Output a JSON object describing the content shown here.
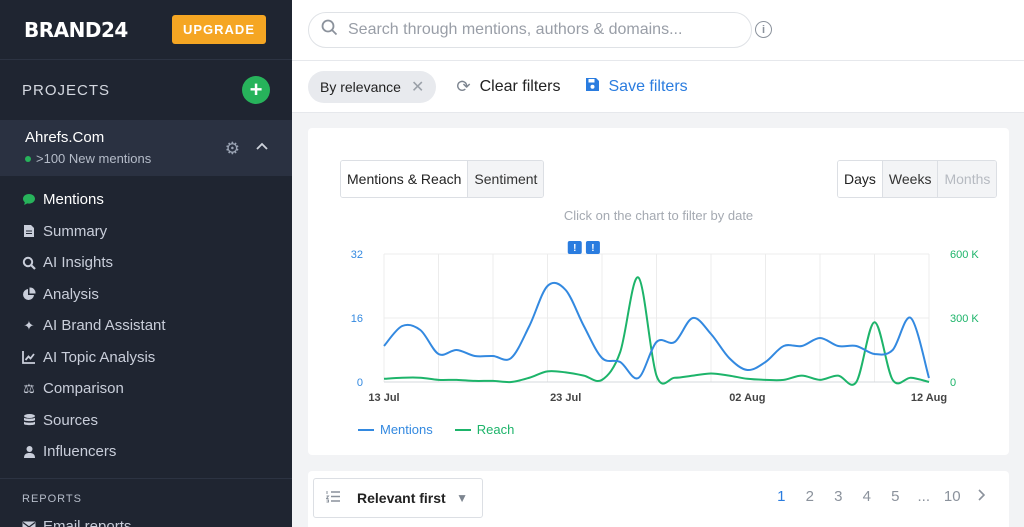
{
  "sidebar": {
    "logo": "BRAND24",
    "upgrade_label": "UPGRADE",
    "projects_label": "PROJECTS",
    "project": {
      "name": "Ahrefs.Com",
      "status": ">100 New mentions"
    },
    "items": [
      {
        "label": "Mentions",
        "icon": "chat-bubble-icon",
        "active": true
      },
      {
        "label": "Summary",
        "icon": "document-icon"
      },
      {
        "label": "AI Insights",
        "icon": "magnifier-icon"
      },
      {
        "label": "Analysis",
        "icon": "pie-chart-icon"
      },
      {
        "label": "AI Brand Assistant",
        "icon": "sparkle-icon"
      },
      {
        "label": "AI Topic Analysis",
        "icon": "trend-chart-icon"
      },
      {
        "label": "Comparison",
        "icon": "scale-icon"
      },
      {
        "label": "Sources",
        "icon": "database-icon"
      },
      {
        "label": "Influencers",
        "icon": "person-icon"
      }
    ],
    "reports_label": "REPORTS",
    "report_items": [
      {
        "label": "Email reports",
        "icon": "mail-icon"
      }
    ]
  },
  "search": {
    "placeholder": "Search through mentions, authors & domains..."
  },
  "filters": {
    "chip_label": "By relevance",
    "clear_label": "Clear filters",
    "save_label": "Save filters"
  },
  "chart_panel": {
    "tabs": [
      "Mentions & Reach",
      "Sentiment"
    ],
    "active_tab": "Mentions & Reach",
    "ranges": [
      "Days",
      "Weeks",
      "Months"
    ],
    "active_range": "Days",
    "disabled_range": "Months",
    "hint": "Click on the chart to filter by date"
  },
  "chart_data": {
    "type": "line",
    "x_tick_labels": [
      "13 Jul",
      "23 Jul",
      "02 Aug",
      "12 Aug"
    ],
    "y_left_ticks": [
      "0",
      "16",
      "32"
    ],
    "y_right_ticks": [
      "0",
      "300 K",
      "600 K"
    ],
    "ylim_left": [
      0,
      32
    ],
    "ylim_right": [
      0,
      600000
    ],
    "annotation_markers": [
      {
        "x": 10.5,
        "label": "!"
      },
      {
        "x": 11.5,
        "label": "!"
      }
    ],
    "legend_position": "bottom-left",
    "colors": {
      "mentions": "#3389e0",
      "reach": "#1db46a"
    },
    "series": [
      {
        "name": "Mentions",
        "axis": "left",
        "x": [
          0,
          1,
          2,
          3,
          4,
          5,
          6,
          7,
          8,
          9,
          10,
          11,
          12,
          13,
          14,
          15,
          16,
          17,
          18,
          19,
          20,
          21,
          22,
          23,
          24,
          25,
          26,
          27,
          28,
          29,
          30
        ],
        "values": [
          9,
          14,
          13,
          7,
          8,
          6.5,
          6.5,
          6,
          14,
          24,
          23,
          14,
          6,
          5,
          1,
          10,
          10,
          16,
          12,
          6,
          3,
          5,
          9,
          9,
          11,
          9,
          9,
          7,
          8,
          16,
          1
        ]
      },
      {
        "name": "Reach",
        "axis": "right",
        "x": [
          0,
          1,
          2,
          3,
          4,
          5,
          6,
          7,
          8,
          9,
          10,
          11,
          12,
          13,
          14,
          15,
          16,
          17,
          18,
          19,
          20,
          21,
          22,
          23,
          24,
          25,
          26,
          27,
          28,
          29,
          30
        ],
        "values": [
          15000,
          20000,
          20000,
          10000,
          10000,
          5000,
          5000,
          0,
          20000,
          50000,
          45000,
          30000,
          10000,
          140000,
          490000,
          30000,
          20000,
          30000,
          40000,
          30000,
          15000,
          10000,
          10000,
          30000,
          10000,
          30000,
          0,
          280000,
          10000,
          20000,
          0
        ]
      }
    ]
  },
  "bottom": {
    "sort_label": "Relevant first",
    "pages": [
      "1",
      "2",
      "3",
      "4",
      "5",
      "...",
      "10"
    ],
    "current_page": "1"
  }
}
